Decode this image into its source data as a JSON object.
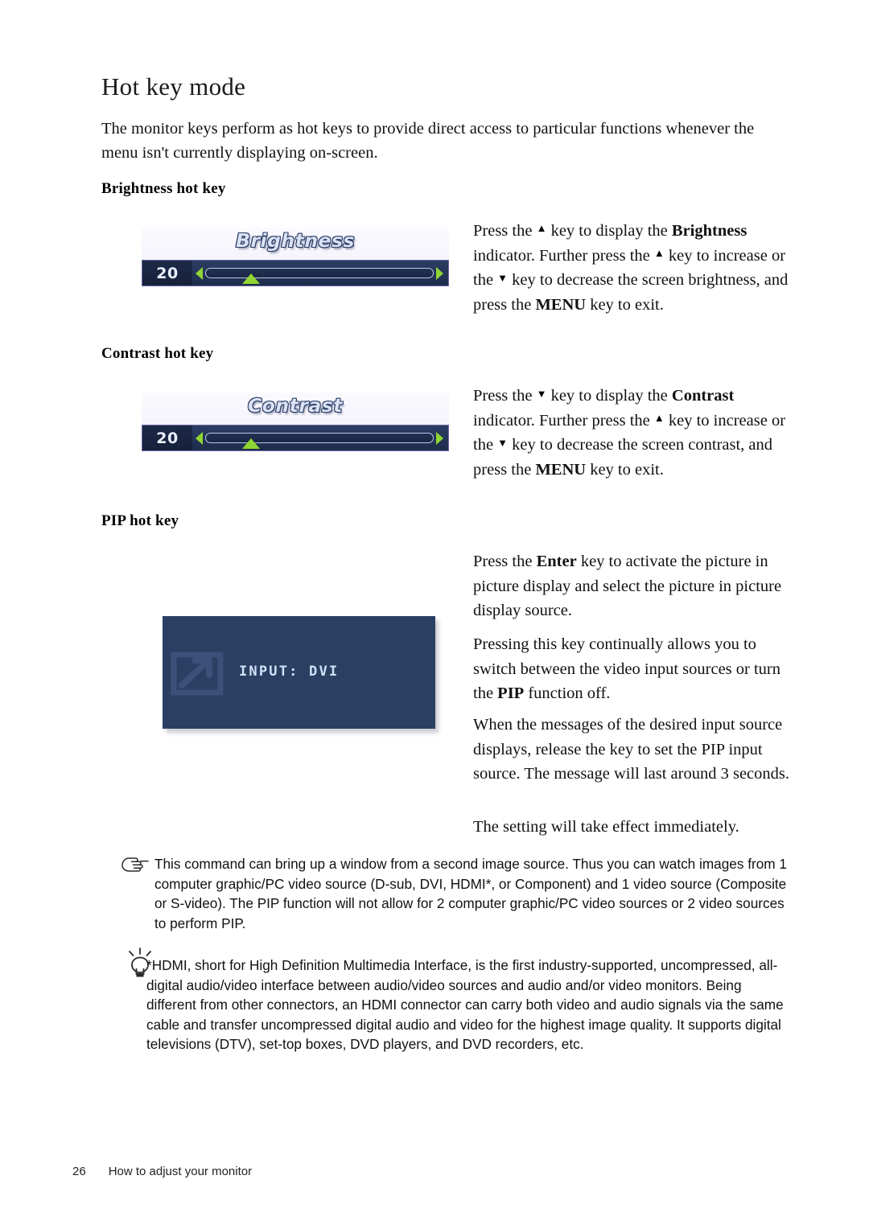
{
  "page": {
    "heading": "Hot key mode",
    "intro": "The monitor keys perform as hot keys to provide direct access to particular functions whenever the menu isn't currently displaying on-screen."
  },
  "brightness_section": {
    "subheading": "Brightness hot key",
    "osd": {
      "title": "Brightness",
      "value": "20",
      "left_arrow_icon": "triangle-left-icon",
      "right_arrow_icon": "triangle-right-icon",
      "knob_icon": "triangle-up-knob-icon",
      "knob_percent": 20
    },
    "text_1": "Press the ",
    "text_2": " key to display the ",
    "bold_1": "Brightness",
    "text_3": " indicator. Further press the ",
    "text_4": " key to increase or the ",
    "text_5": " key to decrease the screen brightness, and press the ",
    "bold_2": "MENU",
    "text_6": " key to exit."
  },
  "contrast_section": {
    "subheading": "Contrast hot key",
    "osd": {
      "title": "Contrast",
      "value": "20",
      "left_arrow_icon": "triangle-left-icon",
      "right_arrow_icon": "triangle-right-icon",
      "knob_icon": "triangle-up-knob-icon",
      "knob_percent": 20
    },
    "text_1": "Press the ",
    "text_2": " key to display the ",
    "bold_1": "Contrast",
    "text_3": " indicator. Further press the ",
    "text_4": " key to increase or the ",
    "text_5": " key to decrease the screen contrast, and press the ",
    "bold_2": "MENU",
    "text_6": " key to exit."
  },
  "pip_section": {
    "subheading": "PIP hot key",
    "osd": {
      "label": "INPUT: DVI",
      "icon": "input-source-arrow-icon",
      "background_color": "#2b3f63",
      "text_color": "#cfe2f7"
    },
    "para_1_pre": "Press the ",
    "para_1_bold": "Enter",
    "para_1_post": " key to activate the picture in picture display and select the picture in picture display source.",
    "para_2_pre": "Pressing this key continually allows you to switch between the video input sources or turn the ",
    "para_2_bold": "PIP",
    "para_2_post": " function off.",
    "para_3": "When the messages of the desired input source displays, release the key to set the PIP input source. The message will last around 3 seconds.",
    "para_4": "The setting will take effect immediately."
  },
  "notes": [
    {
      "icon": "pointing-hand-icon",
      "text": "This command can bring up a window from a second image source. Thus you can watch images from 1 computer graphic/PC video source (D-sub, DVI, HDMI*, or Component) and 1 video source (Composite or S-video). The PIP function will not allow for 2 computer graphic/PC video sources or 2 video sources to perform PIP."
    },
    {
      "icon": "light-bulb-icon",
      "text": "*HDMI, short for High Definition Multimedia Interface, is the first industry-supported, uncompressed, all-digital audio/video interface between audio/video sources and audio and/or video monitors. Being different from other connectors, an HDMI connector can carry both video and audio signals via the same cable and transfer uncompressed digital audio and video for the highest image quality. It supports digital televisions (DTV), set-top boxes, DVD players, and DVD recorders, etc."
    }
  ],
  "footer": {
    "page_number": "26",
    "chapter": "How to adjust your monitor"
  },
  "arrows": {
    "up": "▲",
    "down": "▼"
  },
  "colors": {
    "osd_accent_green": "#8fd633",
    "osd_panel_blue": "#2c3c63",
    "pip_box_blue": "#2b3f63"
  }
}
